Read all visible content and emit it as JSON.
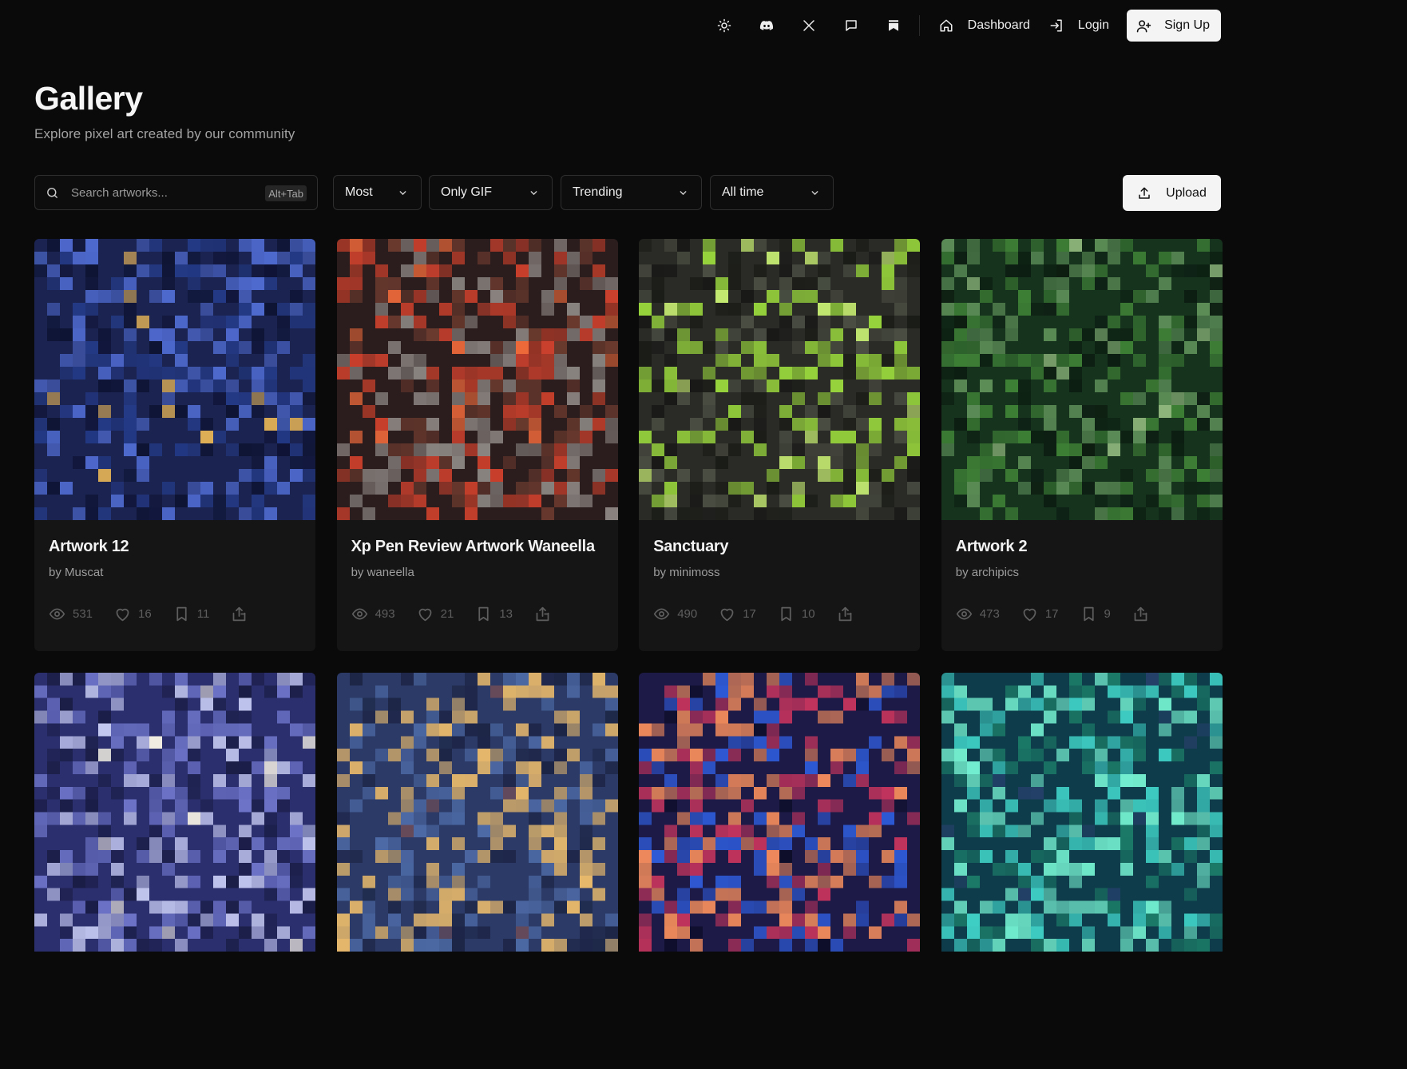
{
  "nav": {
    "icons": [
      "theme-toggle-icon",
      "discord-icon",
      "x-logo-icon",
      "chat-icon",
      "bookmark-icon"
    ],
    "dashboard_label": "Dashboard",
    "login_label": "Login",
    "signup_label": "Sign Up"
  },
  "header": {
    "title": "Gallery",
    "subtitle": "Explore pixel art created by our community"
  },
  "filters": {
    "search_placeholder": "Search artworks...",
    "search_shortcut": "Alt+Tab",
    "sort_value": "Most",
    "type_value": "Only GIF",
    "order_value": "Trending",
    "period_value": "All time",
    "upload_label": "Upload"
  },
  "artworks": [
    {
      "title": "Artwork 12",
      "author": "by Muscat",
      "views": "531",
      "likes": "16",
      "saves": "11",
      "palette": [
        "#1b2350",
        "#243a86",
        "#0e1434",
        "#4f6bd0",
        "#e0b055"
      ]
    },
    {
      "title": "Xp Pen Review Artwork Waneella",
      "author": "by waneella",
      "views": "493",
      "likes": "21",
      "saves": "13",
      "palette": [
        "#2b1d1d",
        "#c9402c",
        "#6b3a2e",
        "#8a8481",
        "#f06a3b"
      ]
    },
    {
      "title": "Sanctuary",
      "author": "by minimoss",
      "views": "490",
      "likes": "17",
      "saves": "10",
      "palette": [
        "#2a2b26",
        "#97d43c",
        "#4b4f43",
        "#191a17",
        "#c9f074"
      ]
    },
    {
      "title": "Artwork 2",
      "author": "by archipics",
      "views": "473",
      "likes": "17",
      "saves": "9",
      "palette": [
        "#16331e",
        "#3e7f36",
        "#5e8f58",
        "#0c1d11",
        "#8fb77c"
      ]
    },
    {
      "palette": [
        "#2b2f6e",
        "#6d74c8",
        "#c3c8f0",
        "#1a1d45",
        "#f1ece2"
      ]
    },
    {
      "palette": [
        "#2b3a66",
        "#4d6aa6",
        "#1d2546",
        "#e6b86b",
        "#6a4b5a"
      ]
    },
    {
      "palette": [
        "#1d1a48",
        "#c1345c",
        "#2e5ad6",
        "#ef8a5b",
        "#0e0e2a"
      ]
    },
    {
      "palette": [
        "#0f3c4a",
        "#3fd0c5",
        "#1b7a67",
        "#74f0d0",
        "#25406a"
      ]
    }
  ]
}
